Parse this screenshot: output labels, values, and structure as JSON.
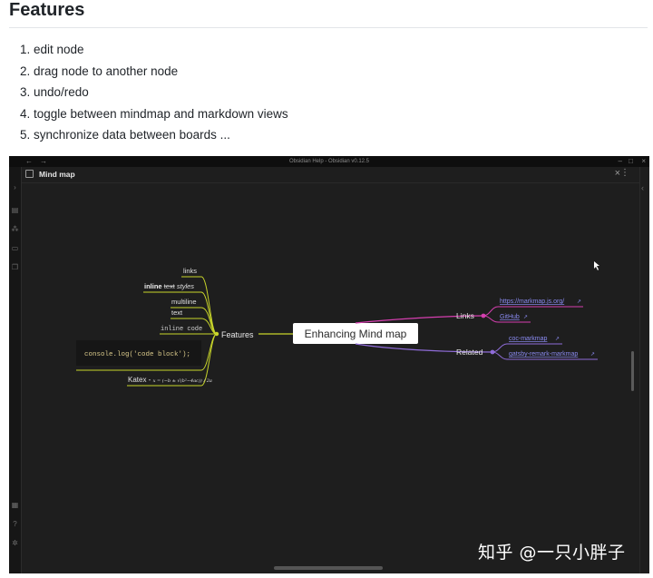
{
  "doc": {
    "title": "Features",
    "features": [
      "1. edit node",
      "2. drag node to another node",
      "3. undo/redo",
      "4. toggle between mindmap and markdown views",
      "5. synchronize data between boards ..."
    ]
  },
  "window": {
    "title": "Obsidian Help - Obsidian v0.12.5",
    "nav_back": "←",
    "nav_forward": "→",
    "minimize": "–",
    "maximize": "□",
    "close": "×",
    "tab_title": "Mind map",
    "tab_close": "×",
    "tab_more": "⋮",
    "ribbon_icons": [
      "chevron-right-icon",
      "file-icon",
      "graph-icon",
      "folder-icon",
      "copy-icon",
      "vault-icon",
      "help-icon",
      "settings-icon"
    ]
  },
  "mindmap": {
    "root": "Enhancing Mind map",
    "features_label": "Features",
    "feature_children": {
      "links": "links",
      "styles_bold": "inline",
      "styles_strike": "text",
      "styles_italic": "styles",
      "multiline_1": "multiline",
      "multiline_2": "text",
      "inline_code": "inline code",
      "code_block": "console.log('code block');",
      "katex_prefix": "Katex - ",
      "katex_formula": "x = (−b ± √(b²−4ac)) / 2a"
    },
    "links_label": "Links",
    "links_children": [
      "https://markmap.js.org/",
      "GitHub"
    ],
    "related_label": "Related",
    "related_children": [
      "coc-markmap",
      "gatsby-remark-markmap"
    ],
    "colors": {
      "features_branch": "#c8d52a",
      "links_branch": "#d63fb0",
      "related_branch": "#8f6cd8",
      "link_text": "#8b8bf2"
    }
  },
  "watermark": "知乎 @一只小胖子"
}
